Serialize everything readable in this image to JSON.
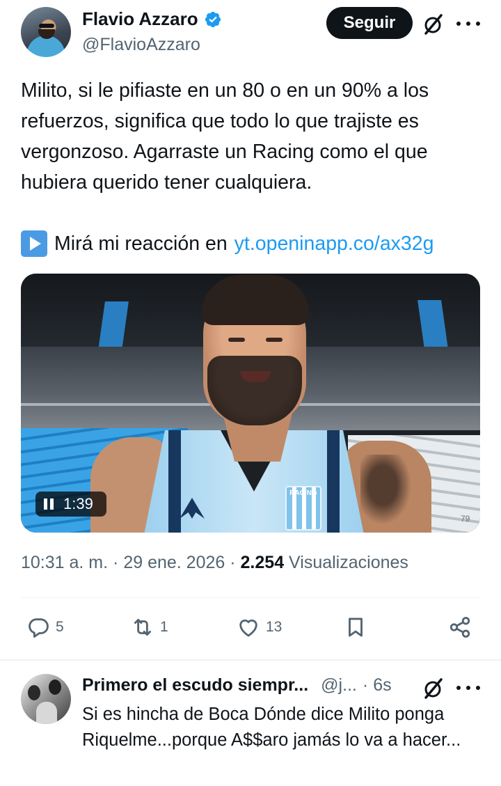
{
  "tweet": {
    "author_name": "Flavio Azzaro",
    "author_handle": "@FlavioAzzaro",
    "follow_label": "Seguir",
    "text": "Milito, si le pifiaste en un 80 o en un 90% a los refuerzos, significa que todo lo que trajiste es vergonzoso. Agarraste un Racing como el que hubiera querido tener cualquiera.",
    "reaction_prefix": "Mirá mi reacción en",
    "link_text": "yt.openinapp.co/ax32g",
    "video": {
      "duration": "1:39",
      "badge_text": "RACING",
      "seat_number": "79"
    },
    "time": "10:31 a. m.",
    "date": "29 ene. 2026",
    "views_count": "2.254",
    "views_label": "Visualizaciones",
    "meta_separator": "·",
    "counts": {
      "replies": "5",
      "reposts": "1",
      "likes": "13"
    }
  },
  "reply": {
    "author_name": "Primero el escudo siempr...",
    "author_handle": "@j...",
    "time": "· 6s",
    "text": "Si es hincha de Boca Dónde dice Milito ponga Riquelme...porque A$$aro jamás lo va a hacer..."
  },
  "icons": {
    "verified": "verified-badge-icon",
    "grok": "grok-icon",
    "more": "more-icon",
    "play": "play-button-icon",
    "pause": "pause-icon",
    "reply": "reply-icon",
    "repost": "repost-icon",
    "like": "like-icon",
    "bookmark": "bookmark-icon",
    "share": "share-icon"
  },
  "colors": {
    "accent": "#1d9bf0",
    "text_primary": "#0f1419",
    "text_secondary": "#536471",
    "follow_button": "#0f1419"
  }
}
